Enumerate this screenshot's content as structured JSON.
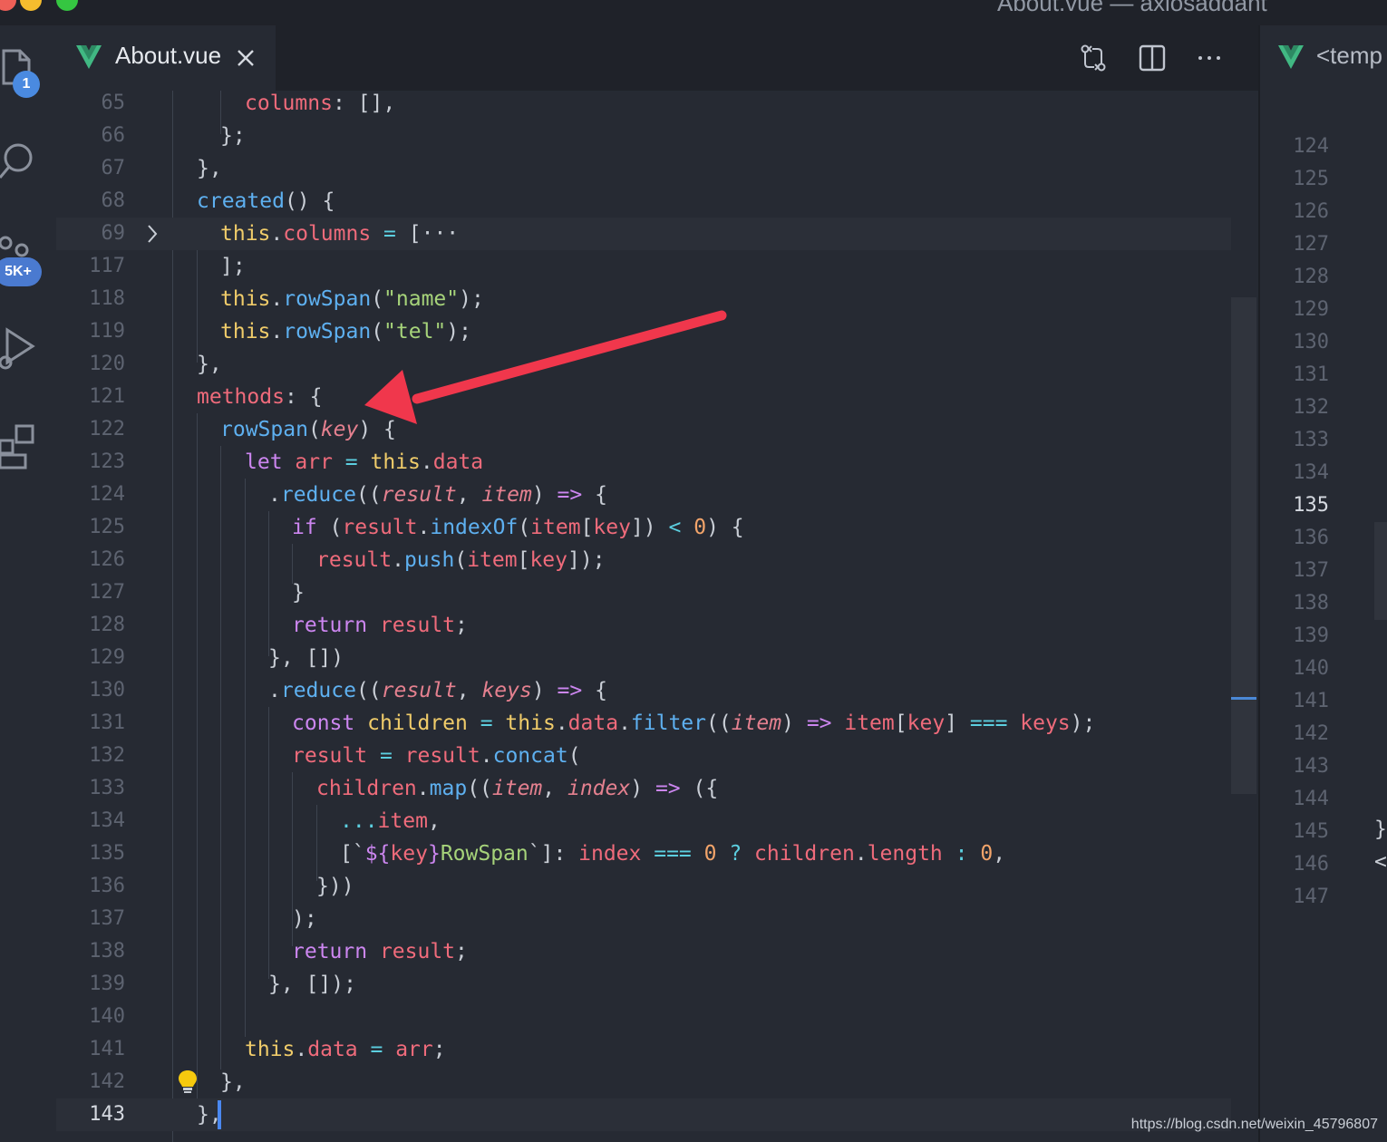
{
  "window": {
    "title": "About.vue — axiosaddant"
  },
  "activity": {
    "explorer_badge": "1",
    "scm_badge": "5K+"
  },
  "tabs": [
    {
      "label": "About.vue",
      "active": true
    }
  ],
  "right_tab": {
    "label": "<temp"
  },
  "editor": {
    "lines": [
      {
        "n": "65"
      },
      {
        "n": "66"
      },
      {
        "n": "67"
      },
      {
        "n": "68"
      },
      {
        "n": "69"
      },
      {
        "n": "117"
      },
      {
        "n": "118"
      },
      {
        "n": "119"
      },
      {
        "n": "120"
      },
      {
        "n": "121"
      },
      {
        "n": "122"
      },
      {
        "n": "123"
      },
      {
        "n": "124"
      },
      {
        "n": "125"
      },
      {
        "n": "126"
      },
      {
        "n": "127"
      },
      {
        "n": "128"
      },
      {
        "n": "129"
      },
      {
        "n": "130"
      },
      {
        "n": "131"
      },
      {
        "n": "132"
      },
      {
        "n": "133"
      },
      {
        "n": "134"
      },
      {
        "n": "135"
      },
      {
        "n": "136"
      },
      {
        "n": "137"
      },
      {
        "n": "138"
      },
      {
        "n": "139"
      },
      {
        "n": "140"
      },
      {
        "n": "141"
      },
      {
        "n": "142"
      },
      {
        "n": "143"
      }
    ],
    "code": {
      "l65": [
        "columns",
        ": [],"
      ],
      "l66": [
        "};"
      ],
      "l67": [
        "},"
      ],
      "l68": [
        "created",
        "() {"
      ],
      "l69": [
        "this",
        ".",
        "columns",
        " = ",
        "[",
        "···"
      ],
      "l117": [
        "];"
      ],
      "l118": [
        "this",
        ".",
        "rowSpan",
        "(",
        "\"name\"",
        ");"
      ],
      "l119": [
        "this",
        ".",
        "rowSpan",
        "(",
        "\"tel\"",
        ");"
      ],
      "l120": [
        "},"
      ],
      "l121": [
        "methods",
        ": {"
      ],
      "l122": [
        "rowSpan",
        "(",
        "key",
        ") {"
      ],
      "l123": [
        "let",
        " arr",
        " = ",
        "this",
        ".",
        "data"
      ],
      "l124": [
        ".",
        "reduce",
        "((",
        "result",
        ", ",
        "item",
        ") ",
        "=>",
        " {"
      ],
      "l125": [
        "if",
        " (",
        "result",
        ".",
        "indexOf",
        "(",
        "item",
        "[",
        "key",
        "]) ",
        "<",
        " 0",
        ") {"
      ],
      "l126": [
        "result",
        ".",
        "push",
        "(",
        "item",
        "[",
        "key",
        "]);"
      ],
      "l127": [
        "}"
      ],
      "l128": [
        "return",
        " result",
        ";"
      ],
      "l129": [
        "}, [])"
      ],
      "l130": [
        ".",
        "reduce",
        "((",
        "result",
        ", ",
        "keys",
        ") ",
        "=>",
        " {"
      ],
      "l131": [
        "const",
        " children",
        " = ",
        "this",
        ".",
        "data",
        ".",
        "filter",
        "((",
        "item",
        ") ",
        "=>",
        " item",
        "[",
        "key",
        "] ",
        "===",
        " keys",
        ");"
      ],
      "l132": [
        "result",
        " = ",
        "result",
        ".",
        "concat",
        "("
      ],
      "l133": [
        "children",
        ".",
        "map",
        "((",
        "item",
        ", ",
        "index",
        ") ",
        "=>",
        " ({"
      ],
      "l134": [
        "...",
        "item",
        ","
      ],
      "l135": [
        "[`",
        "${",
        "key",
        "}",
        "RowSpan",
        "`]: ",
        "index",
        " === ",
        "0",
        " ? ",
        "children",
        ".",
        "length",
        " : ",
        "0",
        ","
      ],
      "l136": [
        "}))"
      ],
      "l137": [
        ");"
      ],
      "l138": [
        "return",
        " result",
        ";"
      ],
      "l139": [
        "}, []);"
      ],
      "l140": [
        ""
      ],
      "l141": [
        "this",
        ".",
        "data",
        " = ",
        "arr",
        ";"
      ],
      "l142": [
        "},"
      ],
      "l143": [
        "},"
      ]
    }
  },
  "right_lines": [
    "124",
    "125",
    "126",
    "127",
    "128",
    "129",
    "130",
    "131",
    "132",
    "133",
    "134",
    "135",
    "136",
    "137",
    "138",
    "139",
    "140",
    "141",
    "142",
    "143",
    "144",
    "145",
    "146",
    "147"
  ],
  "right_active": "135",
  "right_chars": [
    "}",
    "<"
  ],
  "watermark": "https://blog.csdn.net/weixin_45796807"
}
